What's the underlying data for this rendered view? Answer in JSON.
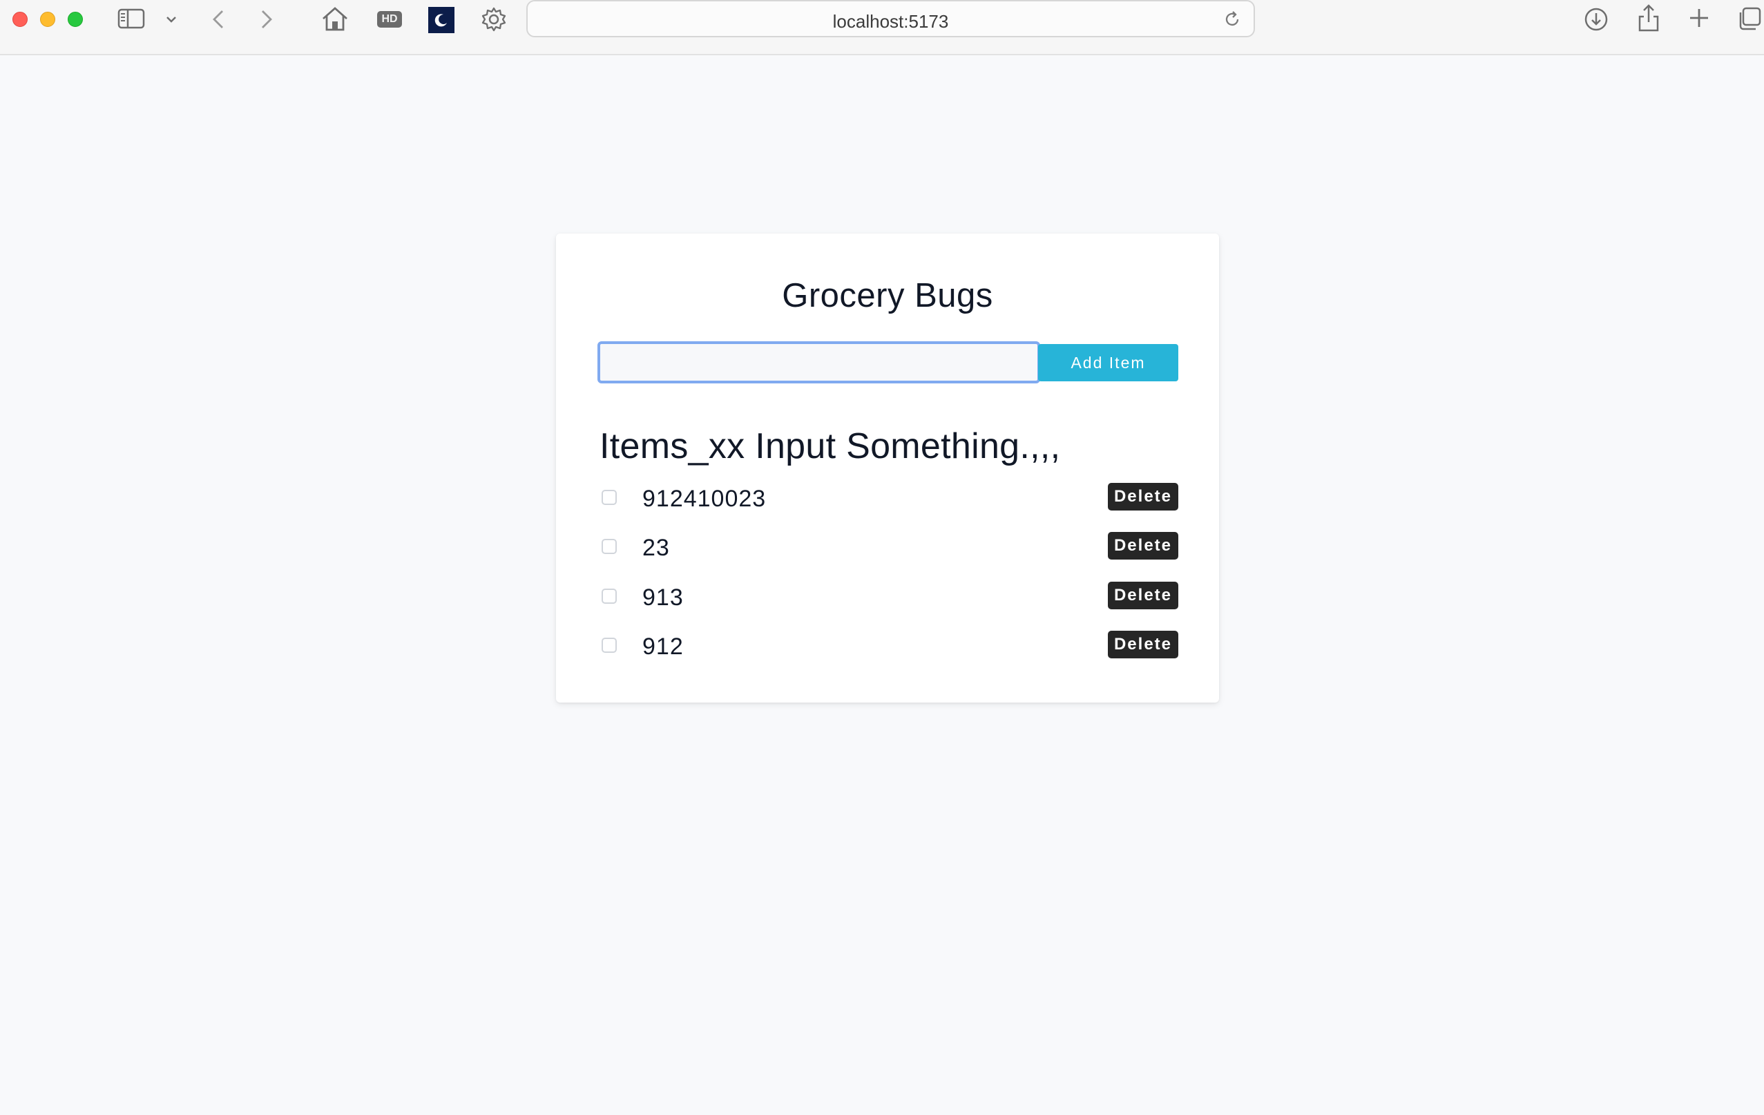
{
  "browser": {
    "url": "localhost:5173",
    "hd_badge": "HD",
    "icons": [
      "sidebar-icon",
      "chevron-down-icon",
      "back-icon",
      "forward-icon",
      "home-icon",
      "hd-icon",
      "dark-mode-icon",
      "settings-icon",
      "reload-icon",
      "download-icon",
      "share-icon",
      "new-tab-icon",
      "tabs-overview-icon"
    ]
  },
  "app": {
    "title": "Grocery Bugs",
    "input_value": "",
    "add_button_label": "Add Item",
    "list_heading": "Items_xx Input Something.,,,",
    "items": [
      {
        "label": "912410023",
        "checked": false,
        "delete_label": "Delete"
      },
      {
        "label": "23",
        "checked": false,
        "delete_label": "Delete"
      },
      {
        "label": "913",
        "checked": false,
        "delete_label": "Delete"
      },
      {
        "label": "912",
        "checked": false,
        "delete_label": "Delete"
      }
    ]
  },
  "colors": {
    "page_background": "#f8f9fb",
    "add_button": "#27b4d8",
    "delete_button": "#262626",
    "input_focus_border": "#80aaf0"
  }
}
